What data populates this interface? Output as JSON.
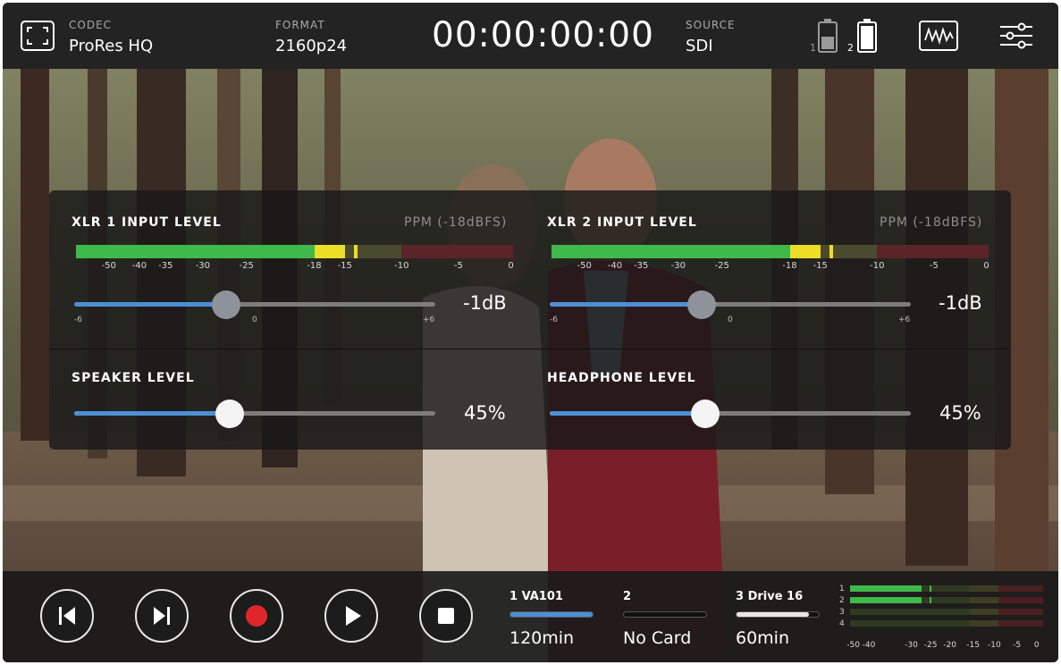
{
  "topbar": {
    "codec_label": "CODEC",
    "codec_value": "ProRes HQ",
    "format_label": "FORMAT",
    "format_value": "2160p24",
    "timecode": "00:00:00:00",
    "source_label": "SOURCE",
    "source_value": "SDI",
    "battery1_label": "1",
    "battery2_label": "2",
    "icons": [
      "fullscreen-icon",
      "battery-icon",
      "battery-icon",
      "waveform-icon",
      "settings-sliders-icon"
    ]
  },
  "audio_panel": {
    "xlr1": {
      "title": "XLR 1 INPUT LEVEL",
      "meter_mode": "PPM (-18dBFS)",
      "ticks": [
        "-50",
        "-40",
        "-35",
        "-30",
        "-25",
        "-18",
        "-15",
        "-10",
        "-5",
        "0"
      ],
      "scale": [
        "-6",
        "0",
        "+6"
      ],
      "gain_fraction": 0.42,
      "value": "-1dB",
      "peak_dBFS": -14
    },
    "xlr2": {
      "title": "XLR 2 INPUT LEVEL",
      "meter_mode": "PPM (-18dBFS)",
      "ticks": [
        "-50",
        "-40",
        "-35",
        "-30",
        "-25",
        "-18",
        "-15",
        "-10",
        "-5",
        "0"
      ],
      "scale": [
        "-6",
        "0",
        "+6"
      ],
      "gain_fraction": 0.42,
      "value": "-1dB",
      "peak_dBFS": -14
    },
    "speaker": {
      "title": "SPEAKER LEVEL",
      "fraction": 0.43,
      "value": "45%"
    },
    "headphone": {
      "title": "HEADPHONE LEVEL",
      "fraction": 0.43,
      "value": "45%"
    }
  },
  "transport": {
    "buttons": [
      "skip-back-icon",
      "skip-forward-icon",
      "record-icon",
      "play-icon",
      "stop-icon"
    ]
  },
  "media_slots": [
    {
      "title": "1  VA101",
      "fill_fraction": 1.0,
      "time": "120min",
      "bar_color": "#4d8fd6"
    },
    {
      "title": "2",
      "fill_fraction": 0.0,
      "time": "No Card",
      "bar_color": "#4d8fd6"
    },
    {
      "title": "3  Drive 16",
      "fill_fraction": 0.88,
      "time": "60min",
      "bar_color": "#e8e8e8"
    }
  ],
  "mini_meters": {
    "channels": [
      "1",
      "2",
      "3",
      "4"
    ],
    "scale": [
      "-50",
      "-40",
      "-30",
      "-25",
      "-20",
      "-15",
      "-10",
      "-5",
      "0"
    ]
  },
  "colors": {
    "meter_green": "#3fb94a",
    "meter_yellow": "#ecde27",
    "meter_olive": "#4a4a2e",
    "meter_red": "#5a2428",
    "accent_blue": "#4d8fd6",
    "record_red": "#e0262a"
  }
}
